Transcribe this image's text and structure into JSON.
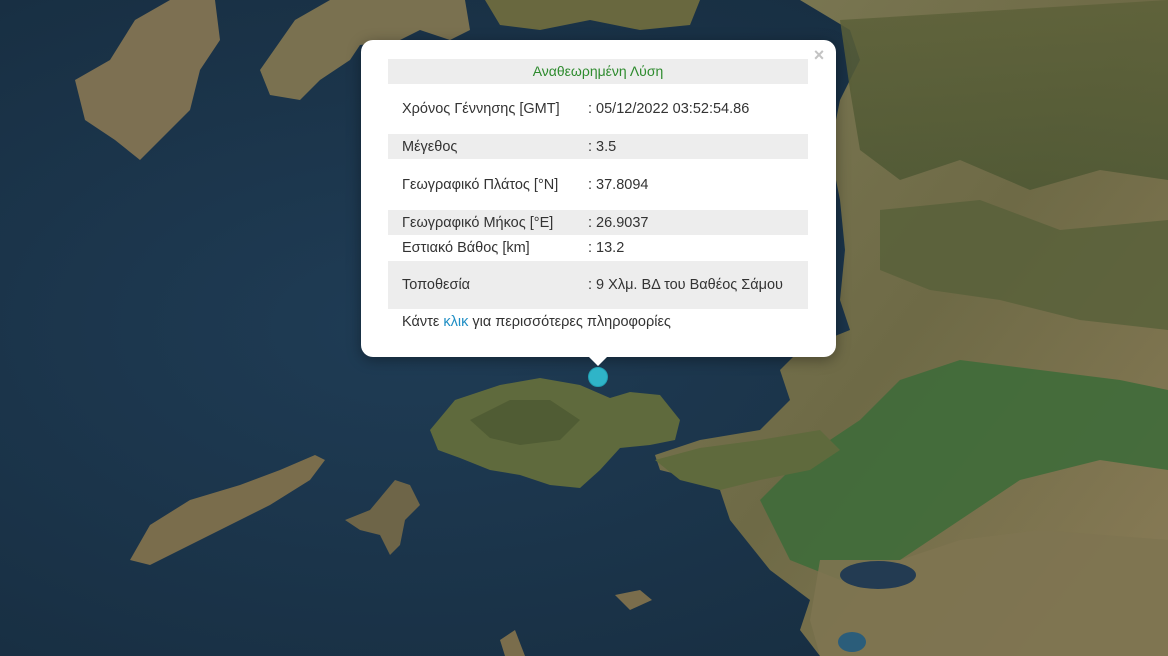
{
  "popup": {
    "title": "Αναθεωρημένη Λύση",
    "close_icon": "close-icon",
    "rows": [
      {
        "label": "Χρόνος Γέννησης [GMT]",
        "value": ": 05/12/2022 03:52:54.86"
      },
      {
        "label": "Μέγεθος",
        "value": ": 3.5"
      },
      {
        "label": "Γεωγραφικό Πλάτος [°N]",
        "value": ": 37.8094"
      },
      {
        "label": "Γεωγραφικό Μήκος [°E]",
        "value": ": 26.9037"
      },
      {
        "label": "Εστιακό Βάθος [km]",
        "value": ": 13.2"
      },
      {
        "label": "Τοποθεσία",
        "value": ": 9 Χλμ. ΒΔ του Βαθέος Σάμου"
      }
    ],
    "more_prefix": "Κάντε",
    "more_link": "κλικ",
    "more_suffix": "για περισσότερες πληροφορίες"
  },
  "map": {
    "marker_icon": "earthquake-marker-icon",
    "colors": {
      "sea": "#1c3449",
      "land_dry": "#8a7d55",
      "land_green": "#3f6b3a",
      "marker": "#2fb4c8",
      "title_green": "#2e8b2e",
      "link": "#1f8ec4"
    }
  }
}
